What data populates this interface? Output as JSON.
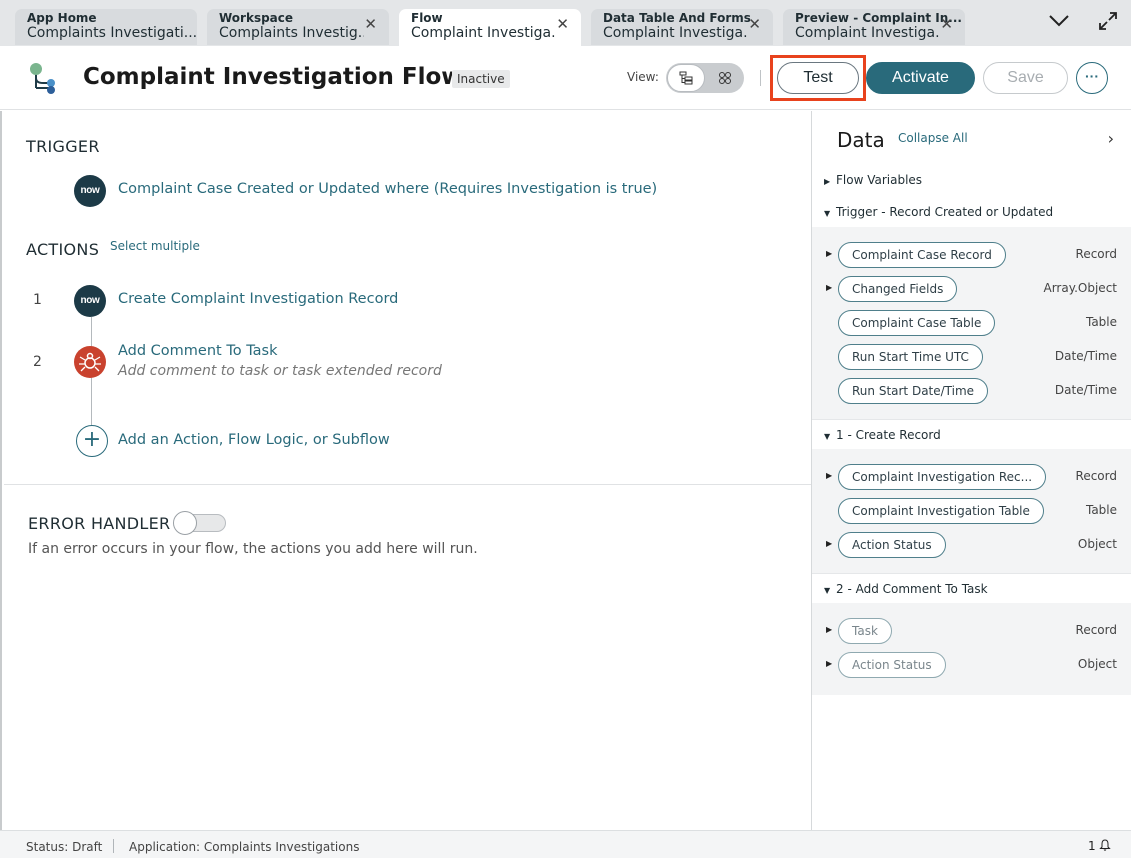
{
  "tabs": [
    {
      "title": "App Home",
      "subtitle": "Complaints Investigati...",
      "closable": false
    },
    {
      "title": "Workspace",
      "subtitle": "Complaints Investig...",
      "closable": true
    },
    {
      "title": "Flow",
      "subtitle": "Complaint Investiga...",
      "closable": true,
      "active": true
    },
    {
      "title": "Data Table And Forms",
      "subtitle": "Complaint Investiga...",
      "closable": true
    },
    {
      "title": "Preview - Complaint In...",
      "subtitle": "Complaint Investiga...",
      "closable": true
    }
  ],
  "header": {
    "title": "Complaint Investigation Flow",
    "state_badge": "Inactive",
    "view_label": "View:",
    "test_label": "Test",
    "activate_label": "Activate",
    "save_label": "Save",
    "more_label": "···"
  },
  "trigger": {
    "heading": "TRIGGER",
    "icon_text": "now",
    "label": "Complaint Case Created or Updated where (Requires Investigation is true)"
  },
  "actions": {
    "heading": "ACTIONS",
    "select_multiple": "Select multiple",
    "steps": [
      {
        "number": "1",
        "icon_text": "now",
        "label": "Create Complaint Investigation Record",
        "sub": ""
      },
      {
        "number": "2",
        "icon_text": "",
        "label": "Add Comment To Task",
        "sub": "Add comment to task or task extended record"
      }
    ],
    "add_label": "Add an Action, Flow Logic, or Subflow",
    "add_symbol": "+"
  },
  "error_handler": {
    "heading": "ERROR HANDLER",
    "enabled": false,
    "description": "If an error occurs in your flow, the actions you add here will run."
  },
  "data_panel": {
    "title": "Data",
    "collapse_all": "Collapse All",
    "chevron": "›",
    "groups": [
      {
        "label": "Flow Variables",
        "expanded": false,
        "items": []
      },
      {
        "label": "Trigger - Record Created or Updated",
        "expanded": true,
        "items": [
          {
            "label": "Complaint Case Record",
            "type": "Record",
            "expandable": true
          },
          {
            "label": "Changed Fields",
            "type": "Array.Object",
            "expandable": true
          },
          {
            "label": "Complaint Case Table",
            "type": "Table",
            "expandable": false
          },
          {
            "label": "Run Start Time UTC",
            "type": "Date/Time",
            "expandable": false
          },
          {
            "label": "Run Start Date/Time",
            "type": "Date/Time",
            "expandable": false
          }
        ]
      },
      {
        "label": "1 - Create Record",
        "expanded": true,
        "items": [
          {
            "label": "Complaint Investigation Rec...",
            "type": "Record",
            "expandable": true
          },
          {
            "label": "Complaint Investigation Table",
            "type": "Table",
            "expandable": false
          },
          {
            "label": "Action Status",
            "type": "Object",
            "expandable": true
          }
        ]
      },
      {
        "label": "2 - Add Comment To Task",
        "expanded": true,
        "items": [
          {
            "label": "Task",
            "type": "Record",
            "expandable": true,
            "muted": true
          },
          {
            "label": "Action Status",
            "type": "Object",
            "expandable": true,
            "muted": true
          }
        ]
      }
    ]
  },
  "footer": {
    "status": "Status: Draft",
    "application": "Application: Complaints Investigations",
    "notifications": "1"
  },
  "colors": {
    "accent": "#296a7b",
    "highlight": "#e8421d",
    "now_icon_bg": "#1c3a47",
    "action_icon_bg": "#c9422e"
  }
}
